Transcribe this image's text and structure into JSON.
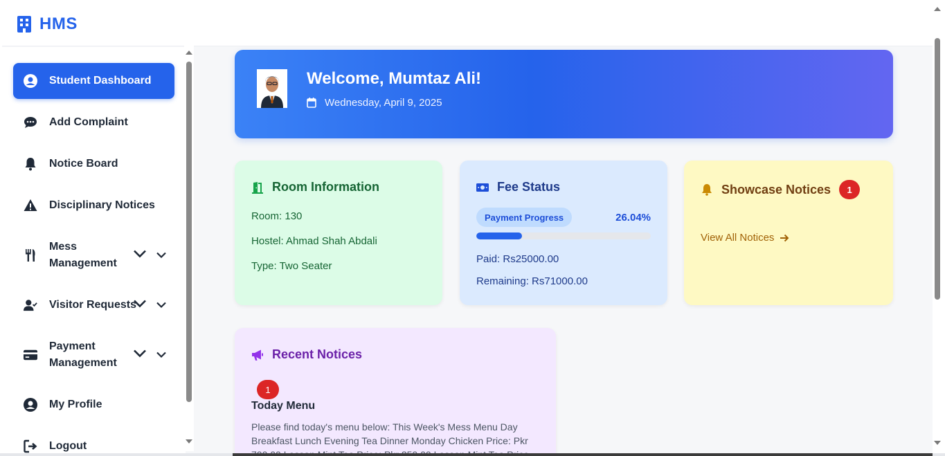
{
  "brand": {
    "name": "HMS"
  },
  "sidebar": {
    "items": [
      {
        "label": "Student Dashboard",
        "icon": "user-circle-icon",
        "active": true
      },
      {
        "label": "Add Complaint",
        "icon": "chat-icon"
      },
      {
        "label": "Notice Board",
        "icon": "bell-icon"
      },
      {
        "label": "Disciplinary Notices",
        "icon": "warning-icon"
      },
      {
        "label": "Mess Management",
        "icon": "utensils-icon"
      },
      {
        "label": "Visitor Requests",
        "icon": "user-check-icon"
      },
      {
        "label": "Payment Management",
        "icon": "credit-card-icon"
      },
      {
        "label": "My Profile",
        "icon": "user-circle-icon"
      },
      {
        "label": "Logout",
        "icon": "logout-icon"
      }
    ]
  },
  "welcome": {
    "title": "Welcome, Mumtaz Ali!",
    "date": "Wednesday, April 9, 2025"
  },
  "room": {
    "title": "Room Information",
    "room": "Room: 130",
    "hostel": "Hostel: Ahmad Shah Abdali",
    "type": "Type: Two Seater"
  },
  "fee": {
    "title": "Fee Status",
    "progress_label": "Payment Progress",
    "progress_text": "26.04%",
    "progress_value": 0.2604,
    "paid": "Paid: Rs25000.00",
    "remaining": "Remaining: Rs71000.00"
  },
  "showcase": {
    "title": "Showcase Notices",
    "count": "1",
    "view_all": "View All Notices"
  },
  "recent": {
    "title": "Recent Notices",
    "count": "1",
    "notice_title": "Today Menu",
    "notice_body": "Please find today's menu below: This Week's Mess Menu Day Breakfast Lunch Evening Tea Dinner Monday Chicken Price: Pkr 700.00 Lassan Mint Tea Price: Pkr 250.00 Lassan Mint Tea Price"
  },
  "colors": {
    "accent": "#2563eb",
    "room_bg": "#dcfce7",
    "fee_bg": "#dbeafe",
    "showcase_bg": "#fef9c3",
    "recent_bg": "#f3e8ff",
    "badge": "#dc2626"
  }
}
